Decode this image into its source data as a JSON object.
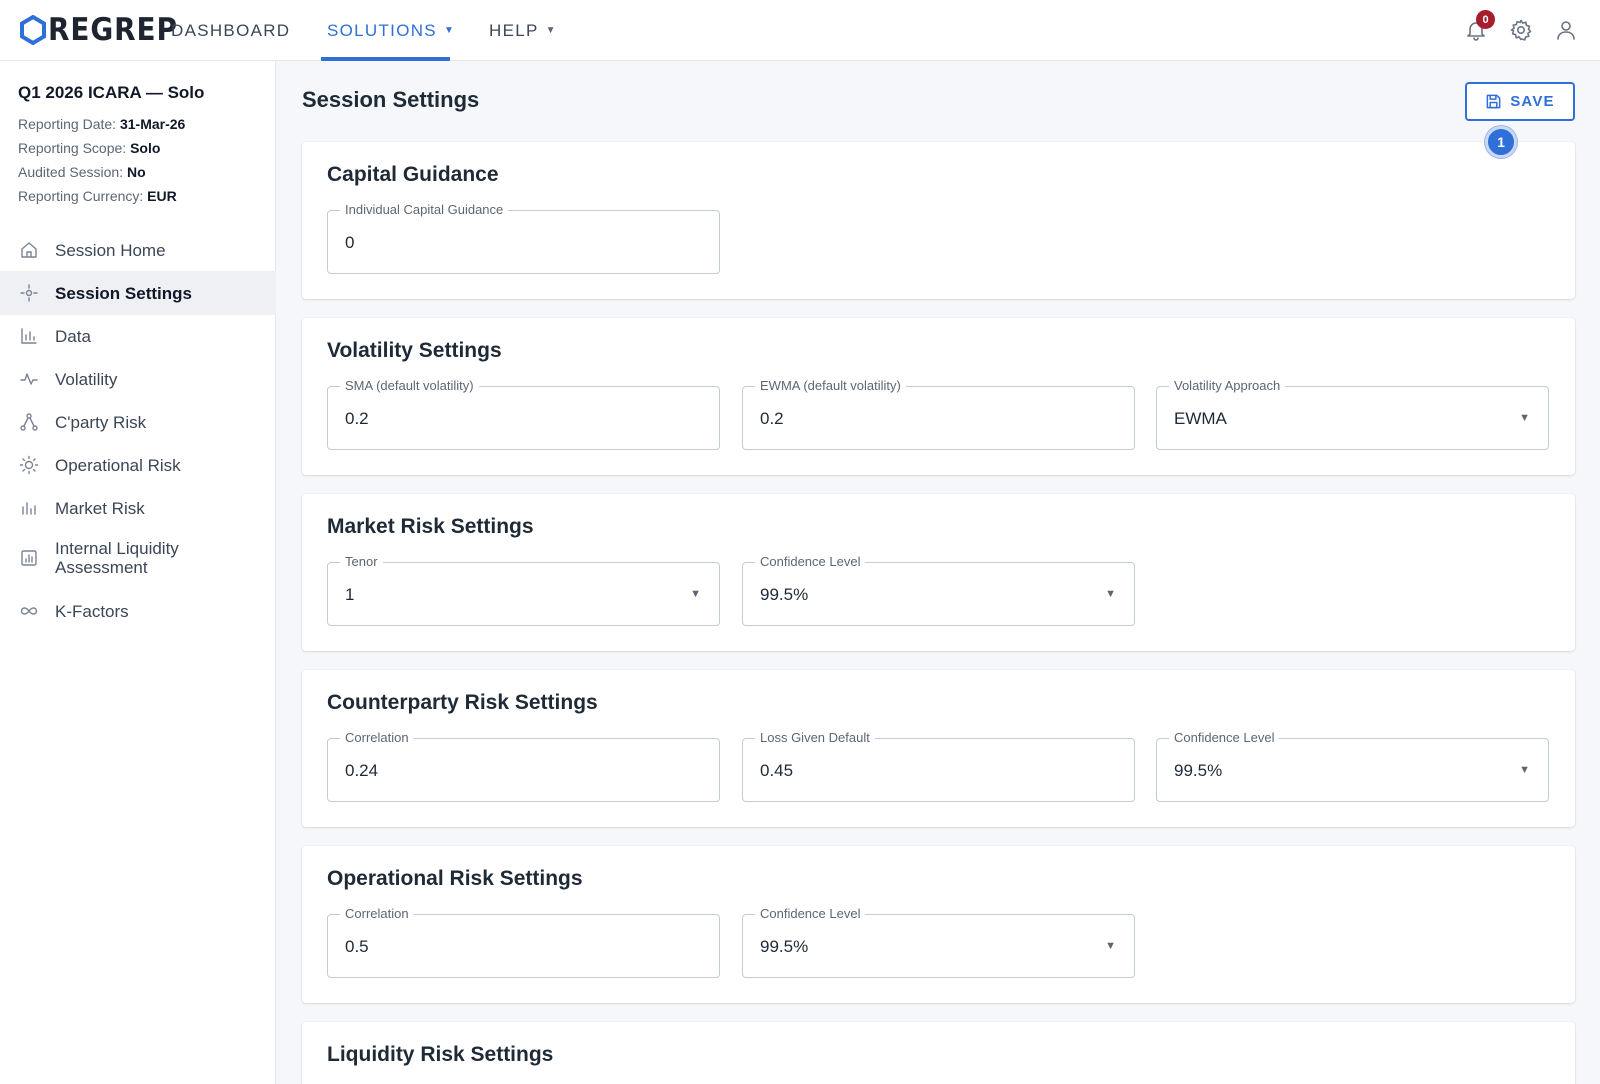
{
  "app": {
    "brand": "REGREP",
    "nav": [
      {
        "label": "DASHBOARD"
      },
      {
        "label": "SOLUTIONS"
      },
      {
        "label": "HELP"
      }
    ],
    "notification_count": "0",
    "accent_color": "#2f6fd8",
    "badge_color": "#a61d2e"
  },
  "session": {
    "title": "Q1 2026 ICARA — Solo",
    "meta": [
      {
        "label": "Reporting Date:",
        "value": "31-Mar-26"
      },
      {
        "label": "Reporting Scope:",
        "value": "Solo"
      },
      {
        "label": "Audited Session:",
        "value": "No"
      },
      {
        "label": "Reporting Currency:",
        "value": "EUR"
      }
    ]
  },
  "sidebar": {
    "items": [
      {
        "label": "Session Home",
        "icon": "home-icon"
      },
      {
        "label": "Session Settings",
        "icon": "settings-crosshair-icon",
        "active": true
      },
      {
        "label": "Data",
        "icon": "bar-chart-icon"
      },
      {
        "label": "Volatility",
        "icon": "pulse-icon"
      },
      {
        "label": "C'party Risk",
        "icon": "network-icon"
      },
      {
        "label": "Operational Risk",
        "icon": "sun-icon"
      },
      {
        "label": "Market Risk",
        "icon": "column-chart-icon"
      },
      {
        "label": "Internal Liquidity Assessment",
        "icon": "report-icon"
      },
      {
        "label": "K-Factors",
        "icon": "infinity-icon"
      }
    ]
  },
  "main": {
    "title": "Session Settings",
    "save_label": "SAVE",
    "step_badge": "1",
    "sections": {
      "capital": {
        "title": "Capital Guidance",
        "fields": [
          {
            "label": "Individual Capital Guidance",
            "value": "0"
          }
        ]
      },
      "volatility": {
        "title": "Volatility Settings",
        "fields": [
          {
            "label": "SMA (default volatility)",
            "value": "0.2"
          },
          {
            "label": "EWMA (default volatility)",
            "value": "0.2"
          },
          {
            "label": "Volatility Approach",
            "value": "EWMA"
          }
        ]
      },
      "market": {
        "title": "Market Risk Settings",
        "fields": [
          {
            "label": "Tenor",
            "value": "1"
          },
          {
            "label": "Confidence Level",
            "value": "99.5%"
          }
        ]
      },
      "counterparty": {
        "title": "Counterparty Risk Settings",
        "fields": [
          {
            "label": "Correlation",
            "value": "0.24"
          },
          {
            "label": "Loss Given Default",
            "value": "0.45"
          },
          {
            "label": "Confidence Level",
            "value": "99.5%"
          }
        ]
      },
      "operational": {
        "title": "Operational Risk Settings",
        "fields": [
          {
            "label": "Correlation",
            "value": "0.5"
          },
          {
            "label": "Confidence Level",
            "value": "99.5%"
          }
        ]
      },
      "liquidity": {
        "title": "Liquidity Risk Settings"
      }
    }
  }
}
